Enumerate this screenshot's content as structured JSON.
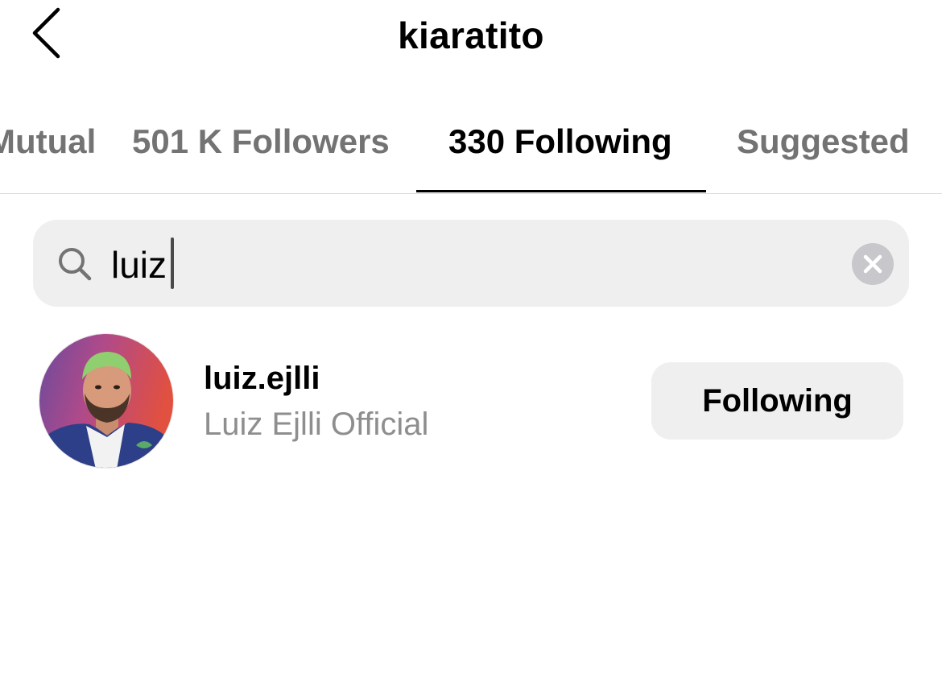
{
  "header": {
    "back_icon": "chevron-left-icon",
    "title": "kiaratito"
  },
  "tabs": [
    {
      "label": "Mutual",
      "active": false
    },
    {
      "label": "501 K Followers",
      "active": false
    },
    {
      "label": "330 Following",
      "active": true
    },
    {
      "label": "Suggested",
      "active": false
    }
  ],
  "search": {
    "icon": "search-icon",
    "value": "luiz",
    "clear_icon": "clear-icon"
  },
  "results": [
    {
      "username": "luiz.ejlli",
      "full_name": "Luiz Ejlli Official",
      "action_label": "Following"
    }
  ],
  "colors": {
    "primary_text": "#000000",
    "secondary_text": "#8e8e8e",
    "inactive_tab": "#737373",
    "surface": "#efefef",
    "divider": "#dbdbdb",
    "clear_button": "#c7c7cc"
  }
}
